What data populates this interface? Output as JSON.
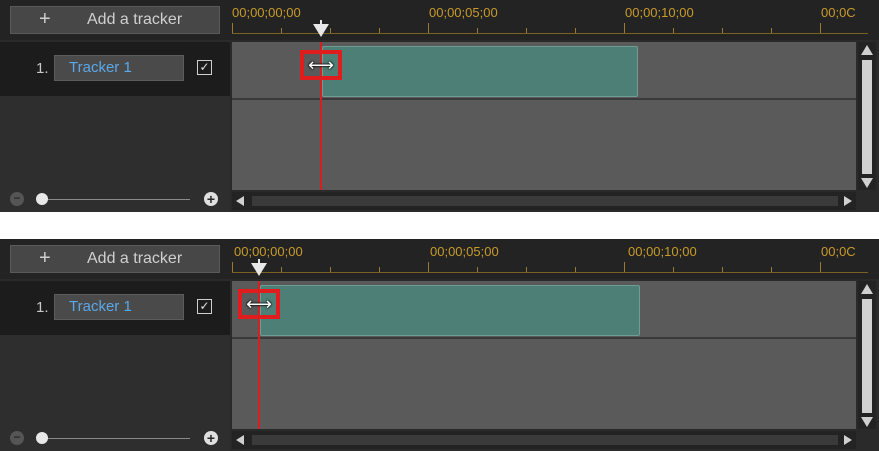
{
  "add_button_label": "Add a tracker",
  "timecodes": [
    "00;00;00;00",
    "00;00;05;00",
    "00;00;10;00",
    "00;0C"
  ],
  "track": {
    "number": "1.",
    "name": "Tracker 1",
    "checked": "☑"
  },
  "colors": {
    "clip": "#4e7f76",
    "timecode": "#c89a2a",
    "highlight": "#e01c1c",
    "track_name": "#5ba8e8"
  },
  "icons": [
    "plus-icon",
    "checkbox-icon",
    "resize-horizontal-cursor-icon",
    "playhead-icon",
    "zoom-out-icon",
    "zoom-in-icon",
    "scroll-up-icon",
    "scroll-down-icon",
    "scroll-left-icon",
    "scroll-right-icon"
  ],
  "cursor_glyph": "⟷"
}
